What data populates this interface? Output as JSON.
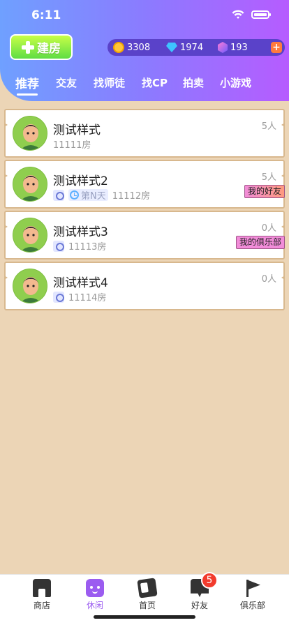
{
  "status": {
    "time": "6:11"
  },
  "header": {
    "build_label": "建房",
    "currency": {
      "coins": "3308",
      "diamonds": "1974",
      "gems": "193",
      "add": "+"
    },
    "tabs": [
      "推荐",
      "交友",
      "找师徒",
      "找CP",
      "拍卖",
      "小游戏"
    ],
    "active_tab": "推荐"
  },
  "rooms": [
    {
      "name": "测试样式",
      "sub": "11111房",
      "count": "5人",
      "badge": ""
    },
    {
      "name": "测试样式2",
      "day": "第N天",
      "sub": "11112房",
      "count": "5人",
      "badge": "我的好友"
    },
    {
      "name": "测试样式3",
      "sub": "11113房",
      "count": "0人",
      "badge": "我的俱乐部"
    },
    {
      "name": "测试样式4",
      "sub": "11114房",
      "count": "0人",
      "badge": ""
    }
  ],
  "tabbar": {
    "items": [
      {
        "label": "商店",
        "icon": "shop-icon"
      },
      {
        "label": "休闲",
        "icon": "cup-icon"
      },
      {
        "label": "首页",
        "icon": "card-icon"
      },
      {
        "label": "好友",
        "icon": "chat-icon"
      },
      {
        "label": "俱乐部",
        "icon": "flag-icon"
      }
    ],
    "active": "休闲",
    "friend_badge": "5"
  },
  "colors": {
    "accent": "#9b5cf0",
    "bg": "#ecd5b6",
    "header_start": "#6fa0ff",
    "header_end": "#b65cff"
  }
}
